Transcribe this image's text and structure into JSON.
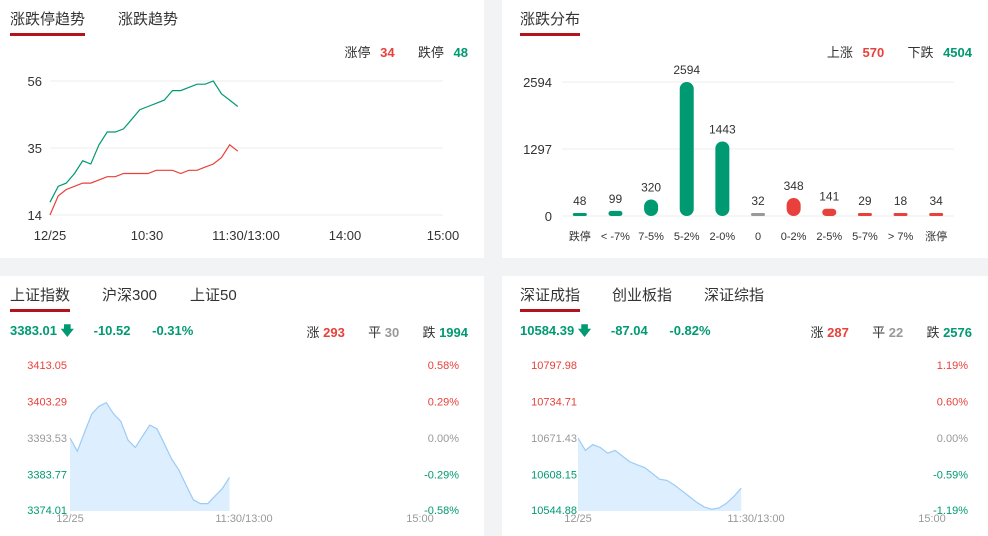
{
  "trend_panel": {
    "tabs": [
      "涨跌停趋势",
      "涨跌趋势"
    ],
    "limit_up_label": "涨停",
    "limit_up_count": "34",
    "limit_down_label": "跌停",
    "limit_down_count": "48"
  },
  "dist_panel": {
    "tabs": [
      "涨跌分布"
    ],
    "up_label": "上涨",
    "up_count": "570",
    "down_label": "下跌",
    "down_count": "4504"
  },
  "sh_panel": {
    "tabs": [
      "上证指数",
      "沪深300",
      "上证50"
    ],
    "price": "3383.01",
    "arrow": "down-arrow-icon",
    "change": "-10.52",
    "change_pct": "-0.31%",
    "up_label": "涨",
    "up_count": "293",
    "flat_label": "平",
    "flat_count": "30",
    "down_label": "跌",
    "down_count": "1994"
  },
  "sz_panel": {
    "tabs": [
      "深证成指",
      "创业板指",
      "深证综指"
    ],
    "price": "10584.39",
    "arrow": "down-arrow-icon",
    "change": "-87.04",
    "change_pct": "-0.82%",
    "up_label": "涨",
    "up_count": "287",
    "flat_label": "平",
    "flat_count": "22",
    "down_label": "跌",
    "down_count": "2576"
  },
  "colors": {
    "up": "#e8403b",
    "down": "#009a72",
    "flat": "#999999",
    "tab_underline": "#b3141c",
    "area_fill": "#ddeeff",
    "area_line": "#9ccbf4"
  },
  "chart_data": [
    {
      "id": "limit-trend",
      "type": "line",
      "x_ticks": [
        "12/25",
        "10:30",
        "11:30/13:00",
        "14:00",
        "15:00"
      ],
      "y_ticks": [
        "56",
        "35",
        "14"
      ],
      "ylim": [
        14,
        56
      ],
      "sample_interval_min": 5,
      "series": [
        {
          "name": "跌停",
          "color": "#009a72",
          "values": [
            18,
            23,
            24,
            27,
            31,
            30,
            36,
            40,
            40,
            41,
            44,
            47,
            48,
            49,
            50,
            53,
            53,
            54,
            55,
            55,
            56,
            52,
            50,
            48
          ]
        },
        {
          "name": "涨停",
          "color": "#e8403b",
          "values": [
            14,
            20,
            22,
            23,
            24,
            24,
            25,
            26,
            26,
            27,
            27,
            27,
            27,
            28,
            28,
            28,
            27,
            28,
            28,
            29,
            30,
            32,
            36,
            34
          ]
        }
      ]
    },
    {
      "id": "up-down-distribution",
      "type": "bar",
      "y_ticks": [
        "2594",
        "1297",
        "0"
      ],
      "ylim": [
        0,
        2594
      ],
      "categories": [
        "跌停",
        "< -7%",
        "7-5%",
        "5-2%",
        "2-0%",
        "0",
        "0-2%",
        "2-5%",
        "5-7%",
        "> 7%",
        "涨停"
      ],
      "values": [
        48,
        99,
        320,
        2594,
        1443,
        32,
        348,
        141,
        29,
        18,
        34
      ],
      "bar_colors": [
        "#009a72",
        "#009a72",
        "#009a72",
        "#009a72",
        "#009a72",
        "#999999",
        "#e8403b",
        "#e8403b",
        "#e8403b",
        "#e8403b",
        "#e8403b"
      ]
    },
    {
      "id": "sh-index",
      "type": "area",
      "x_ticks": [
        "12/25",
        "11:30/13:00",
        "15:00"
      ],
      "y_ticks": [
        "3413.05",
        "3403.29",
        "3393.53",
        "3383.77",
        "3374.01"
      ],
      "pct_ticks": [
        "0.58%",
        "0.29%",
        "0.00%",
        "-0.29%",
        "-0.58%"
      ],
      "y_tick_colors": [
        "#e8403b",
        "#e8403b",
        "#999999",
        "#009a72",
        "#009a72"
      ],
      "ylim": [
        3374.01,
        3413.05
      ],
      "prev_close": 3393.53,
      "sample_interval_min": 5,
      "values": [
        3393.53,
        3390.0,
        3395.0,
        3400.0,
        3402.0,
        3403.0,
        3400.0,
        3398.0,
        3393.0,
        3391.0,
        3394.0,
        3397.0,
        3396.0,
        3392.0,
        3388.0,
        3385.0,
        3381.0,
        3377.0,
        3376.0,
        3376.0,
        3378.0,
        3380.0,
        3383.01
      ]
    },
    {
      "id": "sz-index",
      "type": "area",
      "x_ticks": [
        "12/25",
        "11:30/13:00",
        "15:00"
      ],
      "y_ticks": [
        "10797.98",
        "10734.71",
        "10671.43",
        "10608.15",
        "10544.88"
      ],
      "pct_ticks": [
        "1.19%",
        "0.60%",
        "0.00%",
        "-0.59%",
        "-1.19%"
      ],
      "y_tick_colors": [
        "#e8403b",
        "#e8403b",
        "#999999",
        "#009a72",
        "#009a72"
      ],
      "ylim": [
        10544.88,
        10797.98
      ],
      "prev_close": 10671.43,
      "sample_interval_min": 5,
      "values": [
        10671.43,
        10650.0,
        10660.0,
        10655.0,
        10645.0,
        10650.0,
        10640.0,
        10630.0,
        10625.0,
        10620.0,
        10610.0,
        10600.0,
        10598.0,
        10590.0,
        10580.0,
        10570.0,
        10560.0,
        10552.0,
        10548.0,
        10550.0,
        10558.0,
        10570.0,
        10584.39
      ]
    }
  ]
}
